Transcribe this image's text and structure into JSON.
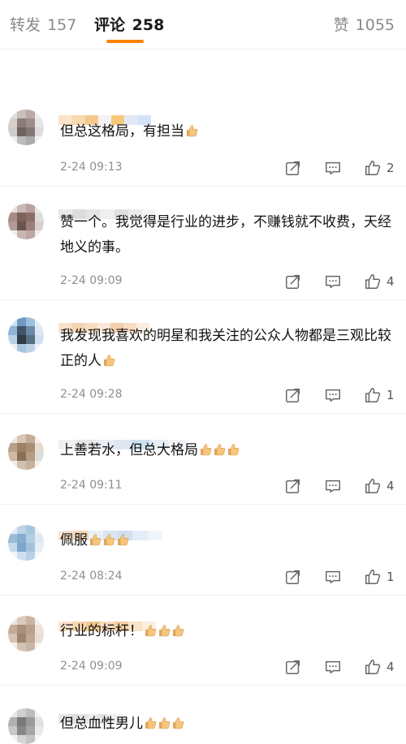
{
  "tabs": {
    "repost": {
      "label": "转发",
      "count": "157"
    },
    "comments": {
      "label": "评论",
      "count": "258"
    },
    "likes": {
      "label": "赞",
      "count": "1055"
    }
  },
  "colors": {
    "accent": "#ff8200",
    "text": "#111111",
    "muted": "#8f8f8f"
  },
  "comments": [
    {
      "text": "但总这格局，有担当",
      "emoji_count": 1,
      "time": "2-24 09:13",
      "likes": "2"
    },
    {
      "text": "赞一个。我觉得是行业的进步，不赚钱就不收费，天经地义的事。",
      "emoji_count": 0,
      "time": "2-24 09:09",
      "likes": "4"
    },
    {
      "text": "我发现我喜欢的明星和我关注的公众人物都是三观比较正的人",
      "emoji_count": 1,
      "time": "2-24 09:28",
      "likes": "1"
    },
    {
      "text": "上善若水，但总大格局",
      "emoji_count": 3,
      "time": "2-24 09:11",
      "likes": "4"
    },
    {
      "text": "佩服",
      "emoji_count": 3,
      "time": "2-24 08:24",
      "likes": "1"
    },
    {
      "text": "行业的标杆！",
      "emoji_count": 3,
      "time": "2-24 09:09",
      "likes": "4"
    },
    {
      "text": "但总血性男儿",
      "emoji_count": 3,
      "time": "",
      "likes": ""
    }
  ],
  "icons": {
    "share": "share-icon",
    "comment": "comment-icon",
    "like": "thumbs-up-icon",
    "emoji": "thumbs-up-emoji"
  }
}
